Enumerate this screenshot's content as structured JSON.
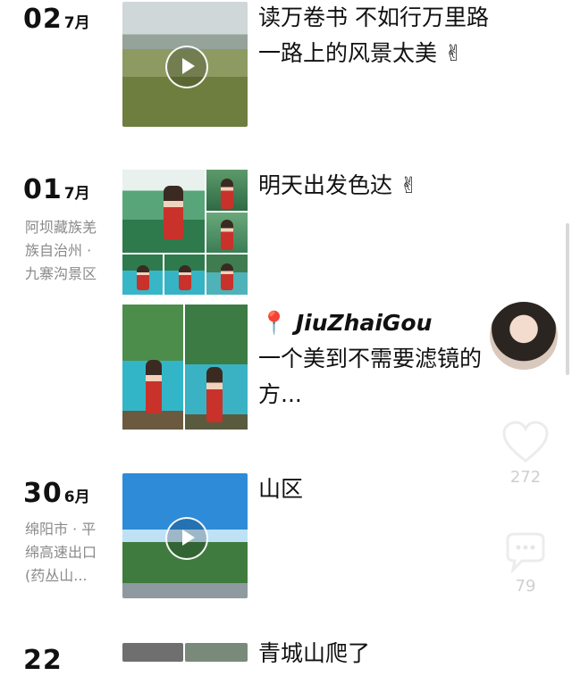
{
  "posts": [
    {
      "day": "02",
      "month": "7月",
      "location": "",
      "text_lines": [
        "读万卷书 不如行万里路",
        "一路上的风景太美"
      ]
    },
    {
      "day": "01",
      "month": "7月",
      "location": "阿坝藏族羌族自治州 · 九寨沟景区",
      "location_lines": [
        "阿坝藏族羌",
        "族自治州 ·",
        "九寨沟景区"
      ],
      "text_lines": [
        "明天出发色达"
      ]
    },
    {
      "tag": "JiuZhaiGou",
      "text_lines": [
        "一个美到不需要滤镜的",
        "方..."
      ]
    },
    {
      "day": "30",
      "month": "6月",
      "location": "绵阳市 · 平绵高速出口(药丛山…",
      "location_lines": [
        "绵阳市 · 平",
        "绵高速出口",
        "(药丛山..."
      ],
      "text_lines": [
        "山区"
      ]
    },
    {
      "day": "22",
      "month": "",
      "text_lines": [
        "青城山爬了"
      ]
    }
  ],
  "side": {
    "like_count": "272",
    "comment_count": "79"
  },
  "icons": [
    "play-icon",
    "victory-hand-emoji",
    "location-pin-icon",
    "heart-icon",
    "comment-icon",
    "avatar"
  ]
}
